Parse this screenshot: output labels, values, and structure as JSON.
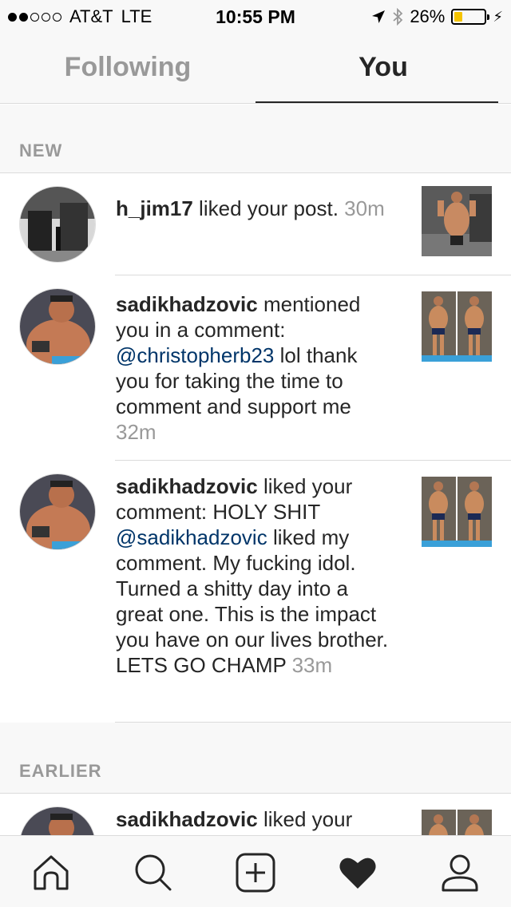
{
  "status_bar": {
    "carrier": "AT&T",
    "network": "LTE",
    "time": "10:55 PM",
    "battery": "26%",
    "battery_level": 0.26
  },
  "tabs": {
    "following": "Following",
    "you": "You"
  },
  "sections": {
    "new": "NEW",
    "earlier": "EARLIER"
  },
  "notifications": [
    {
      "user": "h_jim17",
      "text": " liked your post.",
      "time": "30m"
    },
    {
      "user": "sadikhadzovic",
      "text_pre": " mentioned you in a comment: ",
      "mention": "@christopherb23",
      "text_post": " lol thank you for taking the time to comment and support me",
      "time": "32m"
    },
    {
      "user": "sadikhadzovic",
      "text_pre": " liked your comment: HOLY SHIT ",
      "mention": "@sadikhadzovic",
      "text_post": " liked my comment. My fucking idol. Turned a shitty day into a great one. This is the impact you have on our lives brother. LETS GO CHAMP",
      "time": "33m"
    },
    {
      "user": "sadikhadzovic",
      "text": " liked your"
    }
  ],
  "tabbar": {
    "icons": [
      "home-icon",
      "search-icon",
      "add-post-icon",
      "activity-heart-icon",
      "profile-icon"
    ]
  }
}
